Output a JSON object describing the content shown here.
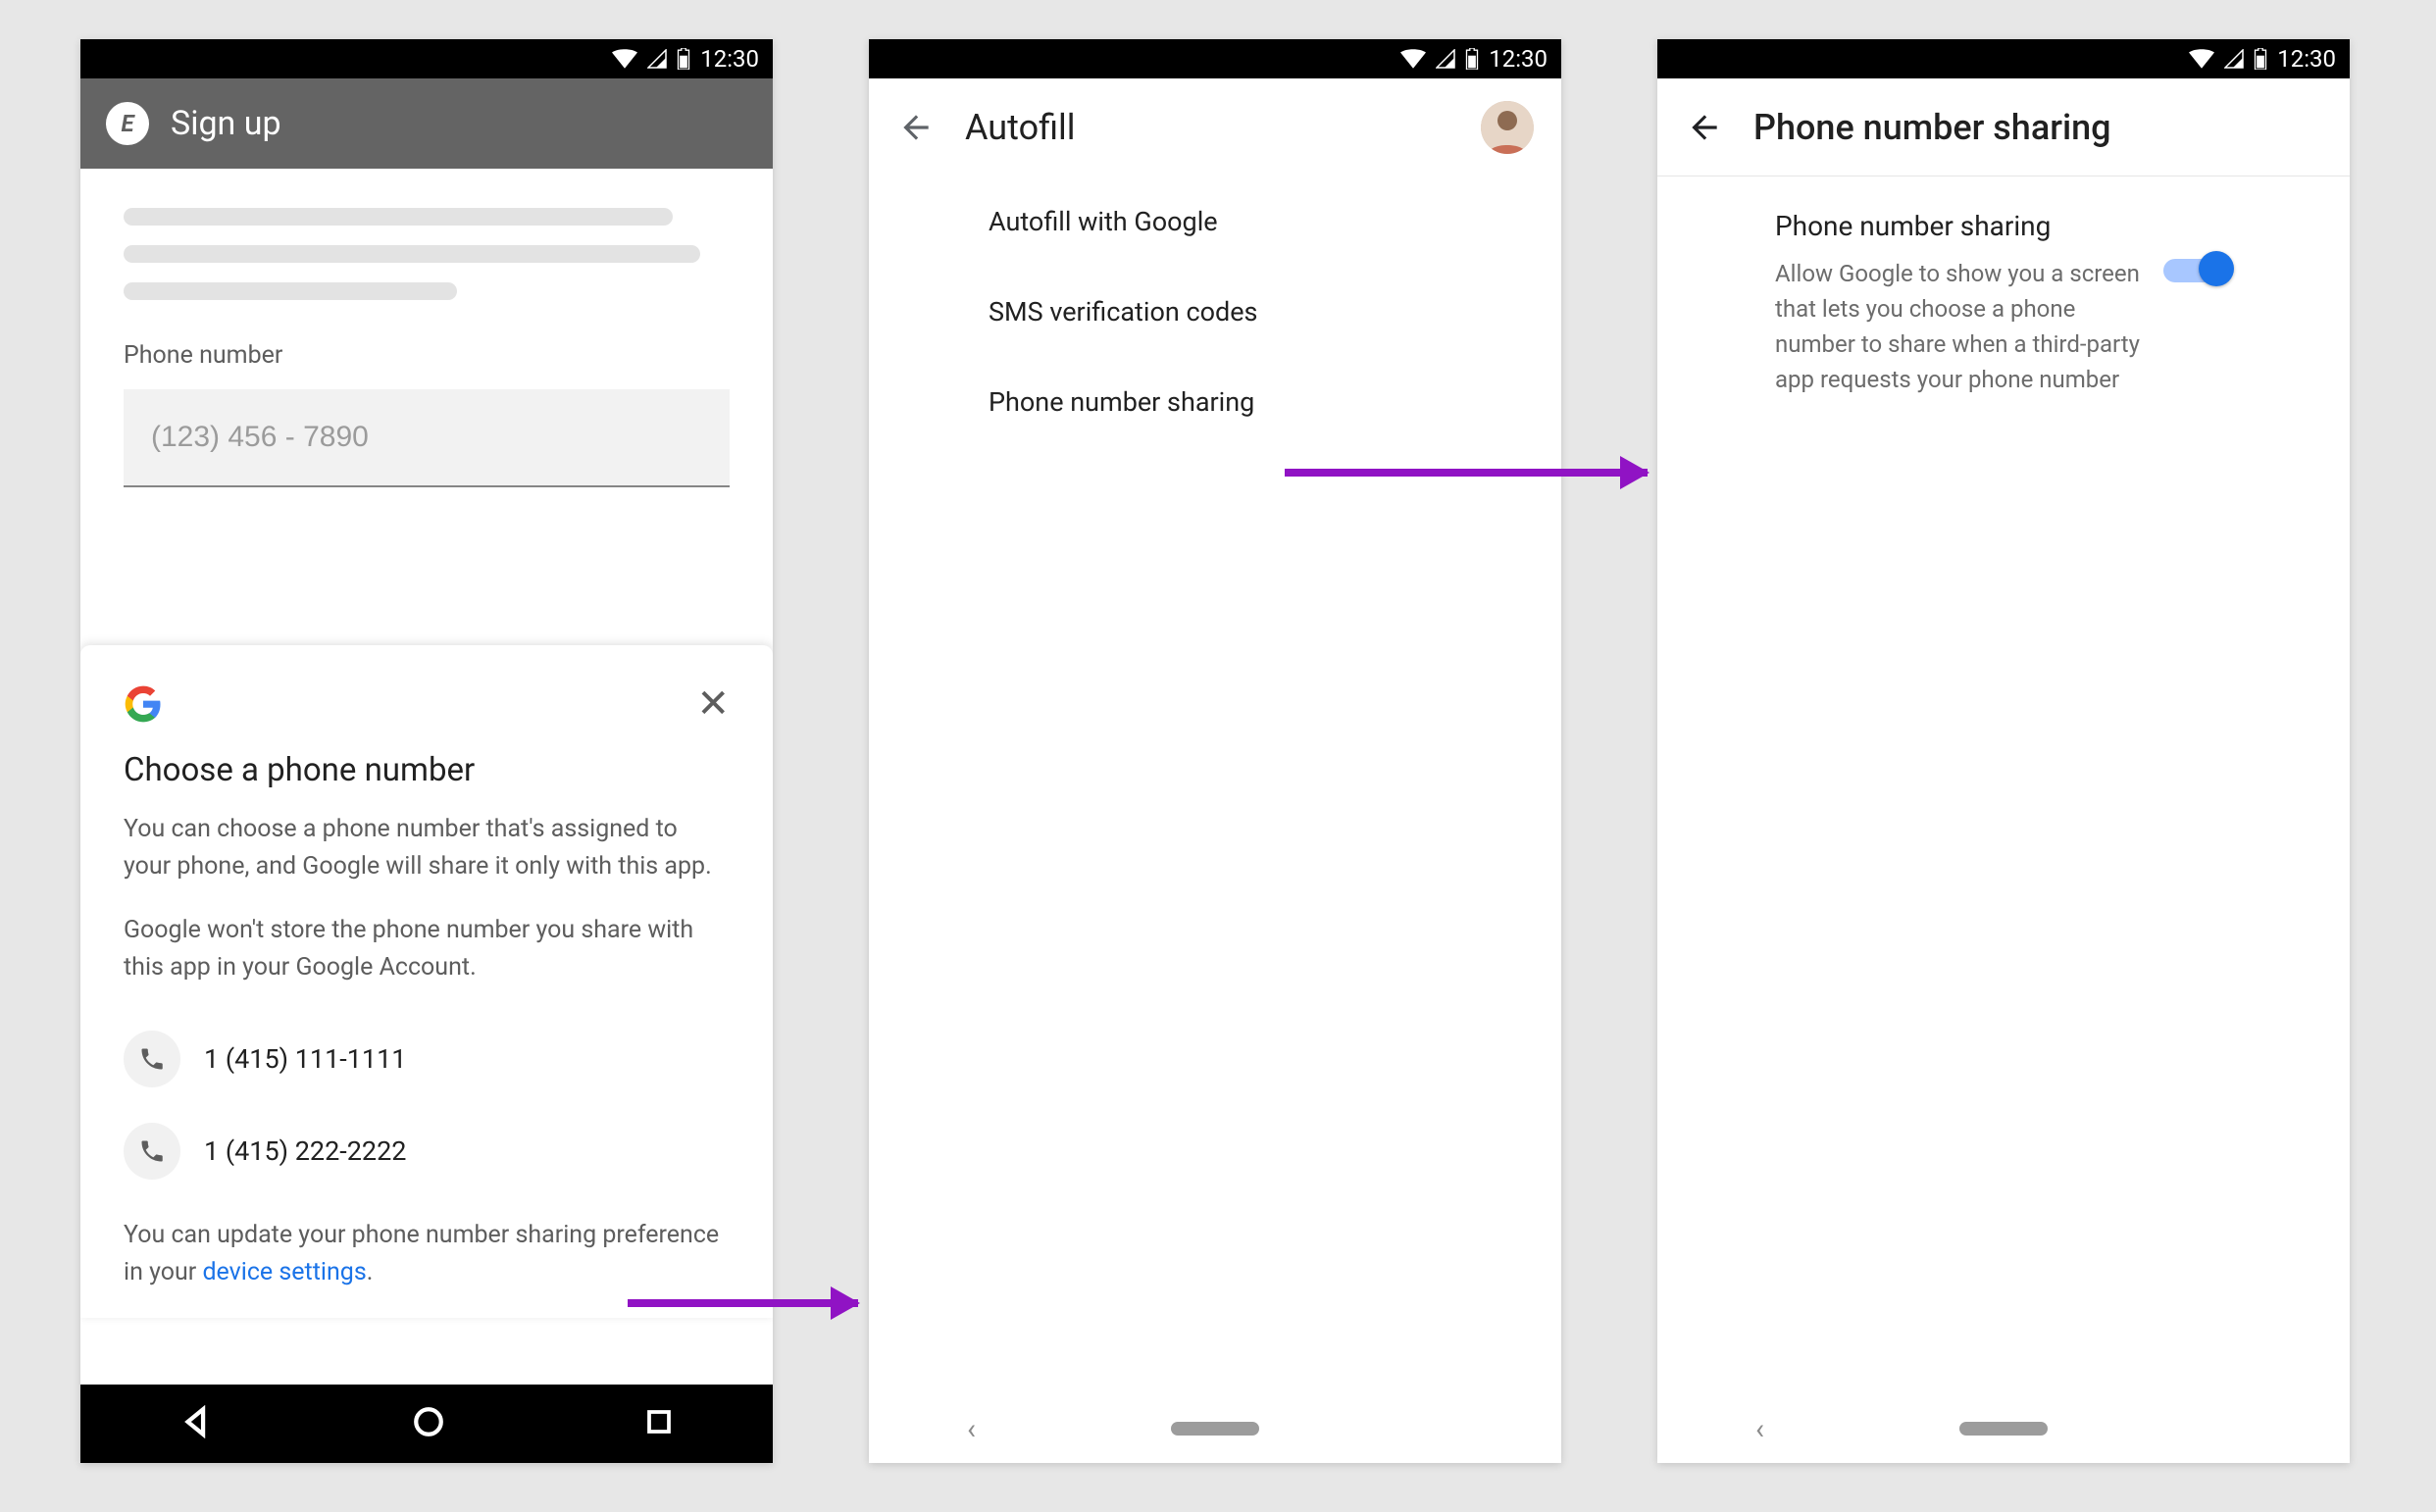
{
  "statusbar": {
    "time": "12:30"
  },
  "screen1": {
    "appbar": {
      "logo_letter": "E",
      "title": "Sign up"
    },
    "field_label": "Phone number",
    "phone_placeholder": "(123) 456 - 7890",
    "sheet": {
      "title": "Choose a phone number",
      "p1": "You can choose a phone number that's assigned to your phone, and Google will share it only with this app.",
      "p2": "Google won't store the phone number you share with this app in your Google Account.",
      "numbers": [
        "1 (415) 111-1111",
        "1 (415) 222-2222"
      ],
      "footer_pre": "You can update your phone number sharing preference in your ",
      "footer_link": "device settings",
      "footer_post": "."
    }
  },
  "screen2": {
    "title": "Autofill",
    "items": [
      "Autofill with Google",
      "SMS verification codes",
      "Phone number sharing"
    ]
  },
  "screen3": {
    "title": "Phone number sharing",
    "setting": {
      "title": "Phone number sharing",
      "desc": "Allow Google to show you a screen that lets you choose a phone number to share when a third-party app requests your phone number"
    }
  }
}
